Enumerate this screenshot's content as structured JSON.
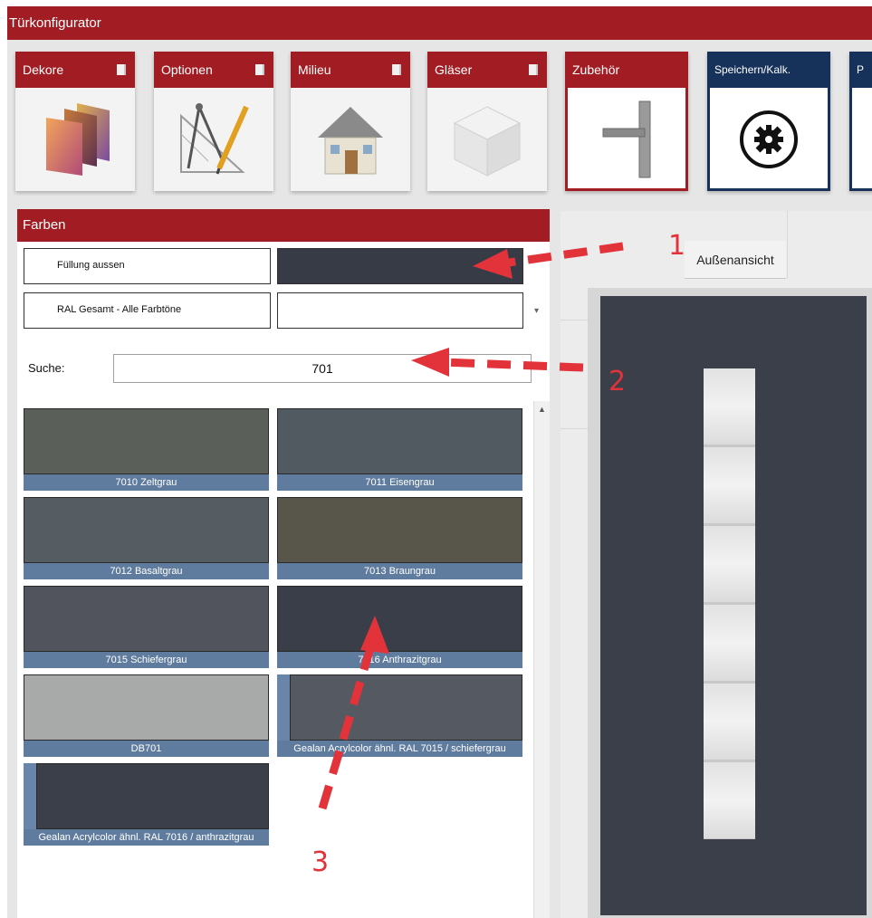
{
  "app": {
    "title": "Türkonfigurator"
  },
  "toolbar": [
    {
      "label": "Dekore",
      "icon": "color-swatches-icon"
    },
    {
      "label": "Optionen",
      "icon": "drafting-tools-icon"
    },
    {
      "label": "Milieu",
      "icon": "house-icon"
    },
    {
      "label": "Gläser",
      "icon": "glass-cube-icon"
    },
    {
      "label": "Zubehör",
      "icon": "door-handle-icon"
    },
    {
      "label": "Speichern/Kalk.",
      "icon": "gear-icon"
    },
    {
      "label": "P",
      "icon": ""
    }
  ],
  "panel": {
    "title": "Farben",
    "fill_label": "Füllung aussen",
    "fill_color": "#363b46",
    "palette_label": "RAL Gesamt - Alle Farbtöne",
    "palette_value": "",
    "search_label": "Suche:",
    "search_value": "701"
  },
  "swatches": [
    {
      "name": "7010 Zeltgrau",
      "color": "#5a5f59"
    },
    {
      "name": "7011 Eisengrau",
      "color": "#515a61"
    },
    {
      "name": "7012 Basaltgrau",
      "color": "#565d62"
    },
    {
      "name": "7013 Braungrau",
      "color": "#58564a"
    },
    {
      "name": "7015 Schiefergrau",
      "color": "#51545c"
    },
    {
      "name": "7016 Anthrazitgrau",
      "color": "#3a3e48"
    },
    {
      "name": "DB701",
      "color": "#a8a9a9"
    },
    {
      "name": "Gealan Acrylcolor ähnl. RAL 7015 / schiefergrau",
      "color": "#555962"
    },
    {
      "name": "Gealan Acrylcolor ähnl. RAL 7016 / anthrazitgrau",
      "color": "#3b3f49"
    }
  ],
  "preview": {
    "tab_label": "Außenansicht",
    "door_color": "#3a3f4a"
  },
  "annotations": {
    "a1": "1",
    "a2": "2",
    "a3": "3"
  },
  "colors": {
    "brand_red": "#a21d23",
    "navy": "#16325a",
    "caption_blue": "#5f7c9e",
    "annotation_red": "#e2323a"
  }
}
